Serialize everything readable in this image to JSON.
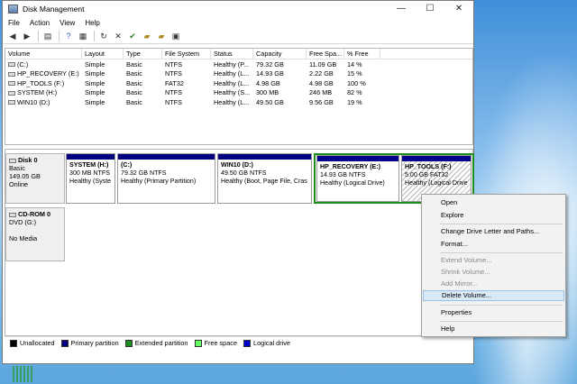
{
  "window": {
    "title": "Disk Management",
    "min": "—",
    "max": "☐",
    "close": "✕"
  },
  "menu": [
    "File",
    "Action",
    "View",
    "Help"
  ],
  "table": {
    "headers": [
      "Volume",
      "Layout",
      "Type",
      "File System",
      "Status",
      "Capacity",
      "Free Spa...",
      "% Free"
    ],
    "rows": [
      [
        "(C:)",
        "Simple",
        "Basic",
        "NTFS",
        "Healthy (P...",
        "79.32 GB",
        "11.09 GB",
        "14 %"
      ],
      [
        "HP_RECOVERY (E:)",
        "Simple",
        "Basic",
        "NTFS",
        "Healthy (L...",
        "14.93 GB",
        "2.22 GB",
        "15 %"
      ],
      [
        "HP_TOOLS (F:)",
        "Simple",
        "Basic",
        "FAT32",
        "Healthy (L...",
        "4.98 GB",
        "4.98 GB",
        "100 %"
      ],
      [
        "SYSTEM (H:)",
        "Simple",
        "Basic",
        "NTFS",
        "Healthy (S...",
        "300 MB",
        "246 MB",
        "82 %"
      ],
      [
        "WIN10 (D:)",
        "Simple",
        "Basic",
        "NTFS",
        "Healthy (L...",
        "49.50 GB",
        "9.56 GB",
        "19 %"
      ]
    ]
  },
  "disk0": {
    "name": "Disk 0",
    "type": "Basic",
    "size": "149.05 GB",
    "status": "Online",
    "partitions": [
      {
        "name": "SYSTEM  (H:)",
        "size": "300 MB NTFS",
        "status": "Healthy (Syste"
      },
      {
        "name": "(C:)",
        "size": "79.32 GB NTFS",
        "status": "Healthy (Primary Partition)"
      },
      {
        "name": "WIN10  (D:)",
        "size": "49.50 GB NTFS",
        "status": "Healthy (Boot, Page File, Cras"
      },
      {
        "name": "HP_RECOVERY  (E:)",
        "size": "14.93 GB NTFS",
        "status": "Healthy (Logical Drive)"
      },
      {
        "name": "HP_TOOLS  (F:)",
        "size": "5.00 GB FAT32",
        "status": "Healthy (Logical Drive"
      }
    ]
  },
  "cdrom": {
    "name": "CD-ROM 0",
    "type": "DVD (G:)",
    "media": "No Media"
  },
  "legend": [
    {
      "label": "Unallocated",
      "color": "#000000"
    },
    {
      "label": "Primary partition",
      "color": "#000080"
    },
    {
      "label": "Extended partition",
      "color": "#1e8c1e"
    },
    {
      "label": "Free space",
      "color": "#66ff66"
    },
    {
      "label": "Logical drive",
      "color": "#0000cc"
    }
  ],
  "context_menu": {
    "open": "Open",
    "explore": "Explore",
    "change_letter": "Change Drive Letter and Paths...",
    "format": "Format...",
    "extend": "Extend Volume...",
    "shrink": "Shrink Volume...",
    "mirror": "Add Mirror...",
    "delete": "Delete Volume...",
    "properties": "Properties",
    "help": "Help"
  }
}
